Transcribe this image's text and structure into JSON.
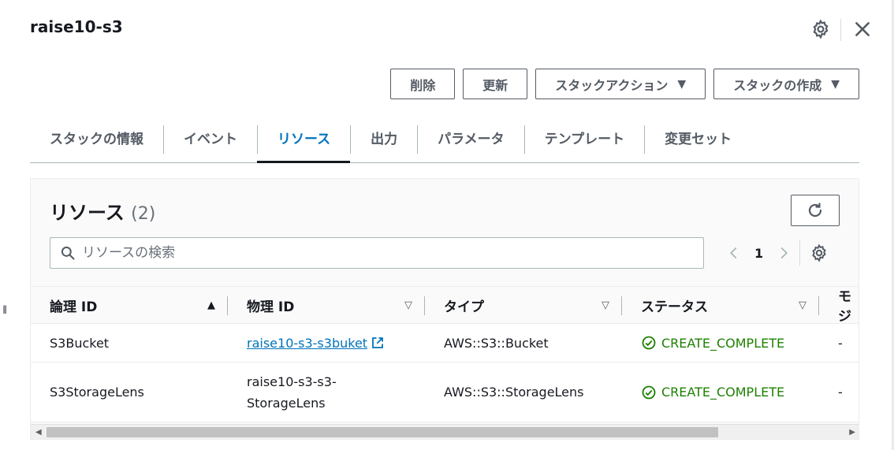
{
  "header": {
    "title": "raise10-s3",
    "gear_icon": "gear-icon",
    "close_icon": "close-icon"
  },
  "actions": {
    "delete_label": "削除",
    "update_label": "更新",
    "stack_actions_label": "スタックアクション",
    "create_stack_label": "スタックの作成",
    "caret": "▼"
  },
  "tabs": [
    {
      "label": "スタックの情報",
      "active": false
    },
    {
      "label": "イベント",
      "active": false
    },
    {
      "label": "リソース",
      "active": true
    },
    {
      "label": "出力",
      "active": false
    },
    {
      "label": "パラメータ",
      "active": false
    },
    {
      "label": "テンプレート",
      "active": false
    },
    {
      "label": "変更セット",
      "active": false
    }
  ],
  "resources": {
    "title": "リソース",
    "count": "(2)",
    "search_placeholder": "リソースの検索",
    "page_number": "1",
    "columns": [
      {
        "label": "論理 ID",
        "sort": "▲"
      },
      {
        "label": "物理 ID",
        "sort": "▽"
      },
      {
        "label": "タイプ",
        "sort": "▽"
      },
      {
        "label": "ステータス",
        "sort": "▽"
      },
      {
        "label": "モジ"
      }
    ],
    "rows": [
      {
        "logical_id": "S3Bucket",
        "physical_id": "raise10-s3-s3buket",
        "physical_is_link": true,
        "type": "AWS::S3::Bucket",
        "status": "CREATE_COMPLETE",
        "module": "-"
      },
      {
        "logical_id": "S3StorageLens",
        "physical_id_line1": "raise10-s3-s3-",
        "physical_id_line2": "StorageLens",
        "type": "AWS::S3::StorageLens",
        "status": "CREATE_COMPLETE",
        "module": "-"
      }
    ]
  },
  "resize_handle_glyph": "II",
  "scroll": {
    "left_arrow": "◀",
    "right_arrow": "▶"
  },
  "colors": {
    "link": "#0073bb",
    "success": "#1d8102",
    "text": "#16191f",
    "border": "#545b64"
  }
}
